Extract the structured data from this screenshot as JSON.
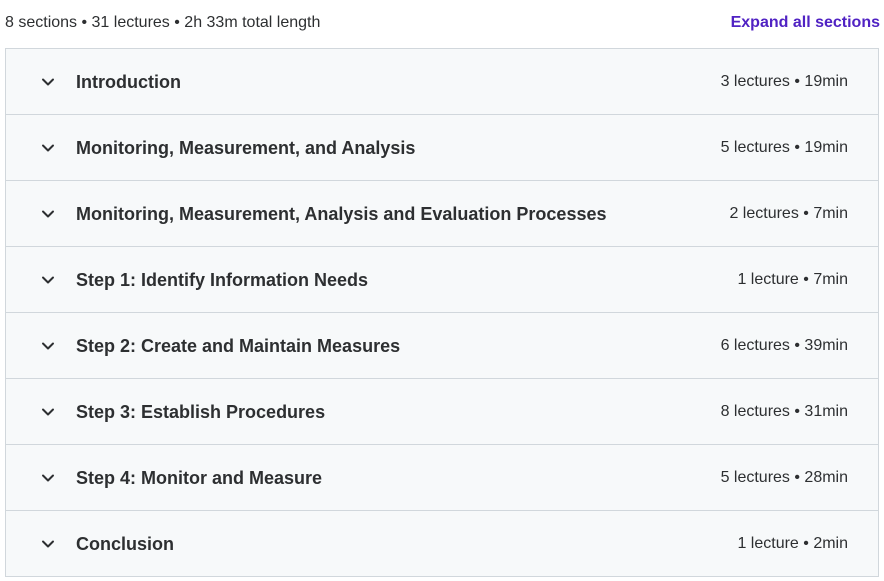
{
  "summary": {
    "text": "8 sections • 31 lectures • 2h 33m total length",
    "expand_label": "Expand all sections"
  },
  "colors": {
    "accent": "#5022c3",
    "row_background": "#f7f9fa",
    "border": "#d1d7dc",
    "text": "#2d2f31"
  },
  "sections": [
    {
      "title": "Introduction",
      "meta": "3 lectures • 19min",
      "icon": "chevron-down-icon"
    },
    {
      "title": "Monitoring, Measurement, and Analysis",
      "meta": "5 lectures • 19min",
      "icon": "chevron-down-icon"
    },
    {
      "title": "Monitoring, Measurement, Analysis and Evaluation Processes",
      "meta": "2 lectures • 7min",
      "icon": "chevron-down-icon"
    },
    {
      "title": "Step 1: Identify Information Needs",
      "meta": "1 lecture • 7min",
      "icon": "chevron-down-icon"
    },
    {
      "title": "Step 2: Create and Maintain Measures",
      "meta": "6 lectures • 39min",
      "icon": "chevron-down-icon"
    },
    {
      "title": "Step 3: Establish Procedures",
      "meta": "8 lectures • 31min",
      "icon": "chevron-down-icon"
    },
    {
      "title": "Step 4: Monitor and Measure",
      "meta": "5 lectures • 28min",
      "icon": "chevron-down-icon"
    },
    {
      "title": "Conclusion",
      "meta": "1 lecture • 2min",
      "icon": "chevron-down-icon"
    }
  ]
}
